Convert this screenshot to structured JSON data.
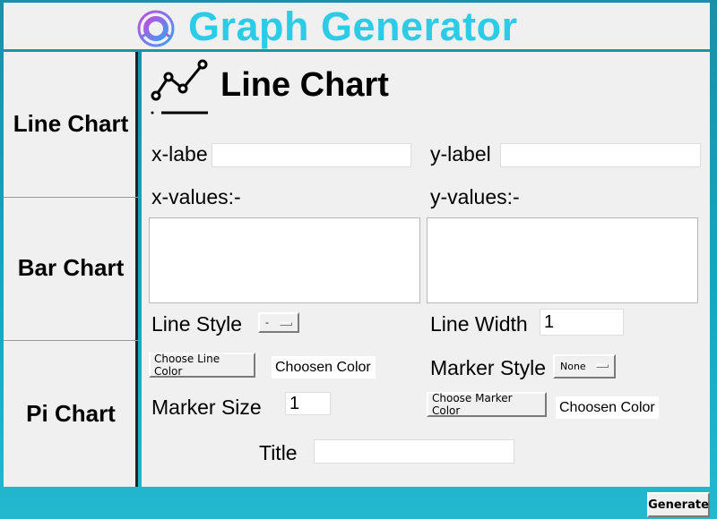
{
  "header": {
    "title": "Graph Generator"
  },
  "sidebar": {
    "items": [
      {
        "label": "Line Chart"
      },
      {
        "label": "Bar Chart"
      },
      {
        "label": "Pi Chart"
      }
    ]
  },
  "panel": {
    "title": "Line Chart",
    "x_label": {
      "label": "x-labe",
      "value": ""
    },
    "y_label": {
      "label": "y-label",
      "value": ""
    },
    "x_values": {
      "label": "x-values:-",
      "value": ""
    },
    "y_values": {
      "label": "y-values:-",
      "value": ""
    },
    "line_style": {
      "label": "Line Style",
      "selected": "-"
    },
    "line_width": {
      "label": "Line Width",
      "value": "1"
    },
    "line_color": {
      "button": "Choose Line Color",
      "chosen": "Choosen Color"
    },
    "marker_style": {
      "label": "Marker Style",
      "selected": "None"
    },
    "marker_size": {
      "label": "Marker Size",
      "value": "1"
    },
    "marker_color": {
      "button": "Choose Marker Color",
      "chosen": "Choosen Color"
    },
    "title_field": {
      "label": "Title",
      "value": ""
    }
  },
  "footer": {
    "generate_label": "Generate"
  },
  "colors": {
    "accent": "#2ccbe6",
    "background": "#1c8fa8",
    "panel": "#f0f0f0"
  },
  "icons": {
    "logo": "donut-chart-logo-icon",
    "chart": "line-chart-icon"
  }
}
